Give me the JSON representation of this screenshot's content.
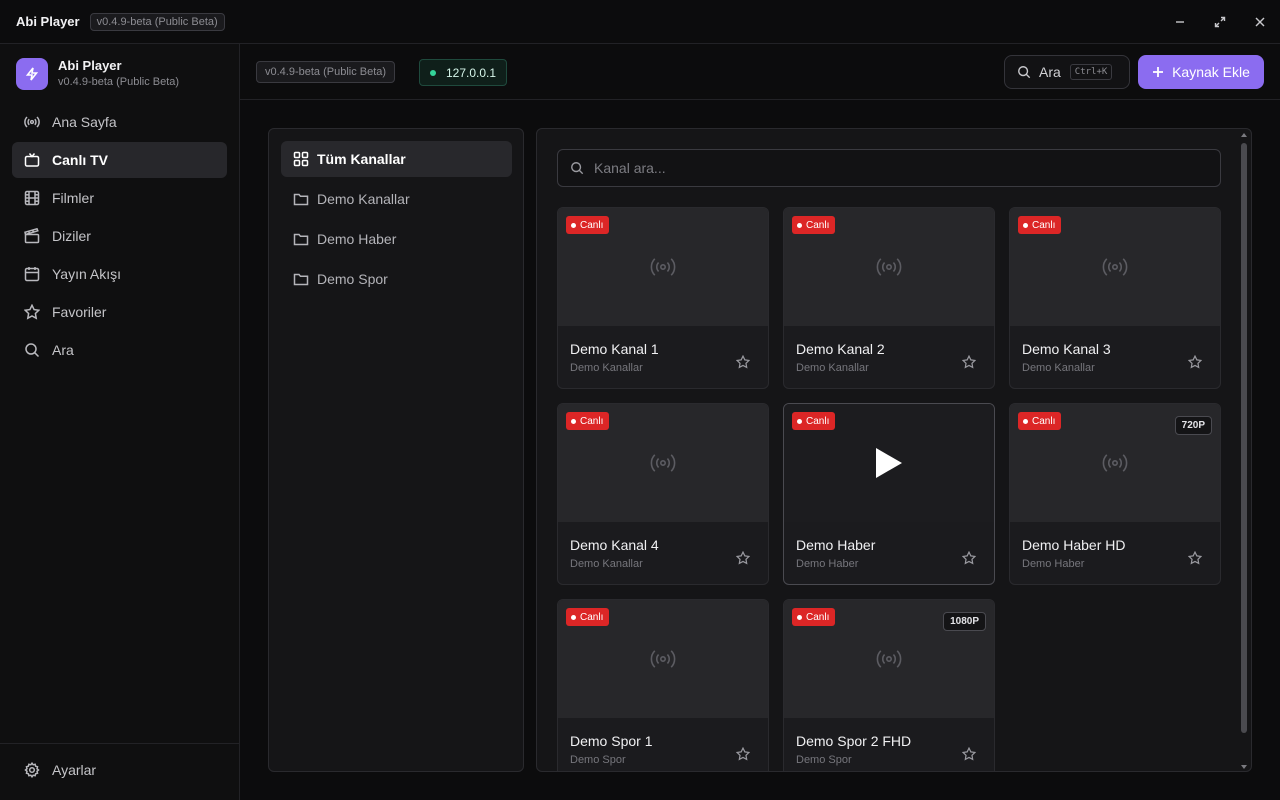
{
  "titlebar": {
    "app_name": "Abi Player",
    "version": "v0.4.9-beta (Public Beta)"
  },
  "sidebar": {
    "brand_title": "Abi Player",
    "brand_subtitle": "v0.4.9-beta (Public Beta)",
    "items": [
      {
        "label": "Ana Sayfa",
        "icon": "broadcast-icon"
      },
      {
        "label": "Canlı TV",
        "icon": "tv-icon",
        "active": true
      },
      {
        "label": "Filmler",
        "icon": "film-icon"
      },
      {
        "label": "Diziler",
        "icon": "clapperboard-icon"
      },
      {
        "label": "Yayın Akışı",
        "icon": "calendar-icon"
      },
      {
        "label": "Favoriler",
        "icon": "star-icon"
      },
      {
        "label": "Ara",
        "icon": "search-icon"
      }
    ],
    "settings_label": "Ayarlar"
  },
  "topbar": {
    "version": "v0.4.9-beta (Public Beta)",
    "server_ip": "127.0.0.1",
    "search_label": "Ara",
    "search_shortcut": "Ctrl+K",
    "add_source_label": "Kaynak Ekle"
  },
  "categories": [
    {
      "label": "Tüm Kanallar",
      "icon": "grid-icon",
      "active": true
    },
    {
      "label": "Demo Kanallar",
      "icon": "folder-icon"
    },
    {
      "label": "Demo Haber",
      "icon": "folder-icon"
    },
    {
      "label": "Demo Spor",
      "icon": "folder-icon"
    }
  ],
  "channel_search": {
    "placeholder": "Kanal ara..."
  },
  "channels": [
    {
      "name": "Demo Kanal 1",
      "group": "Demo Kanallar",
      "live": "Canlı",
      "quality": ""
    },
    {
      "name": "Demo Kanal 2",
      "group": "Demo Kanallar",
      "live": "Canlı",
      "quality": ""
    },
    {
      "name": "Demo Kanal 3",
      "group": "Demo Kanallar",
      "live": "Canlı",
      "quality": ""
    },
    {
      "name": "Demo Kanal 4",
      "group": "Demo Kanallar",
      "live": "Canlı",
      "quality": ""
    },
    {
      "name": "Demo Haber",
      "group": "Demo Haber",
      "live": "Canlı",
      "quality": "",
      "hovered": true
    },
    {
      "name": "Demo Haber HD",
      "group": "Demo Haber",
      "live": "Canlı",
      "quality": "720P"
    },
    {
      "name": "Demo Spor 1",
      "group": "Demo Spor",
      "live": "Canlı",
      "quality": ""
    },
    {
      "name": "Demo Spor 2 FHD",
      "group": "Demo Spor",
      "live": "Canlı",
      "quality": "1080P"
    }
  ],
  "colors": {
    "accent": "#8b6cf0",
    "live": "#dc2626",
    "online": "#34d399"
  }
}
